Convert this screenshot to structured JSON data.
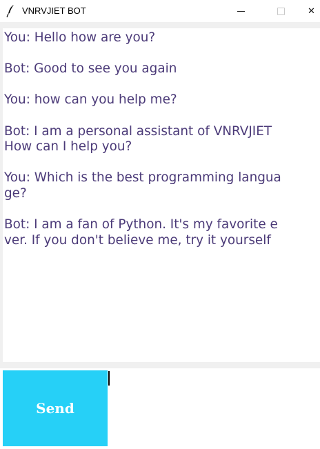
{
  "window": {
    "title": "VNRVJIET BOT",
    "icon": "feather-icon",
    "controls": [
      "minimize-icon",
      "maximize-icon",
      "close-icon"
    ]
  },
  "chat": {
    "text": "You: Hello how are you?\n\nBot: Good to see you again\n\nYou: how can you help me?\n\nBot: I am a personal assistant of VNRVJIET\nHow can I help you?\n\nYou: Which is the best programming langua\nge?\n\nBot: I am a fan of Python. It's my favorite e\nver. If you don't believe me, try it yourself",
    "text_color": "#4b3a78"
  },
  "send_button": {
    "label": "Send",
    "color": "#26d0f7"
  },
  "entry": {
    "value": ""
  }
}
